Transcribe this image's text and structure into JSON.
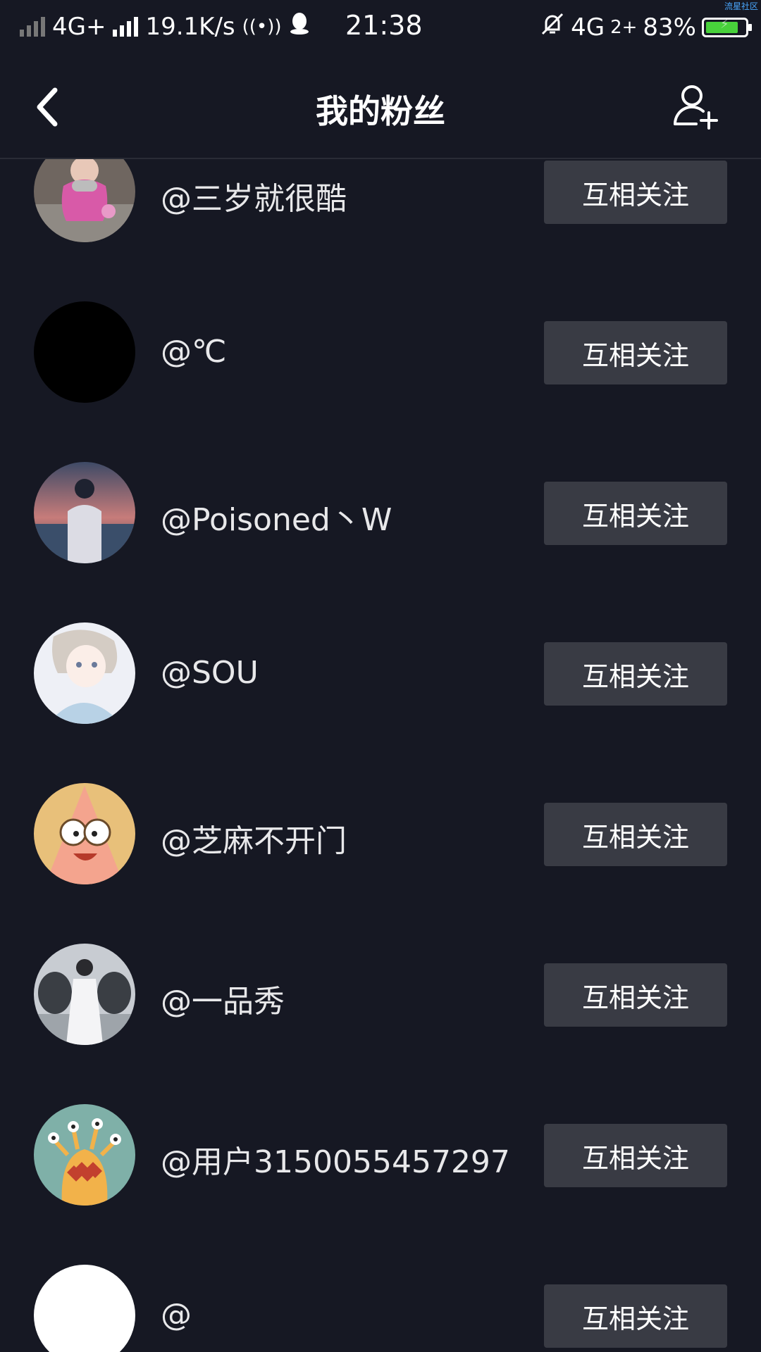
{
  "status_bar": {
    "network1": "4G+",
    "speed": "19.1K/s",
    "time": "21:38",
    "network2": "4G",
    "sim2": "2+",
    "battery": "83%",
    "battery_level": 0.83,
    "watermark": "流星社区"
  },
  "header": {
    "title": "我的粉丝"
  },
  "colors": {
    "background": "#161823",
    "button": "#393b44",
    "battery": "#48d13b"
  },
  "fans": [
    {
      "name": "@三岁就很酷",
      "button": "互相关注"
    },
    {
      "name": "@℃",
      "button": "互相关注"
    },
    {
      "name": "@Poisoned丶W",
      "button": "互相关注"
    },
    {
      "name": "@SOU",
      "button": "互相关注"
    },
    {
      "name": "@芝麻不开门",
      "button": "互相关注"
    },
    {
      "name": "@一品秀",
      "button": "互相关注"
    },
    {
      "name": "@用户3150055457297",
      "button": "互相关注"
    },
    {
      "name": "@",
      "button": "互相关注"
    }
  ]
}
